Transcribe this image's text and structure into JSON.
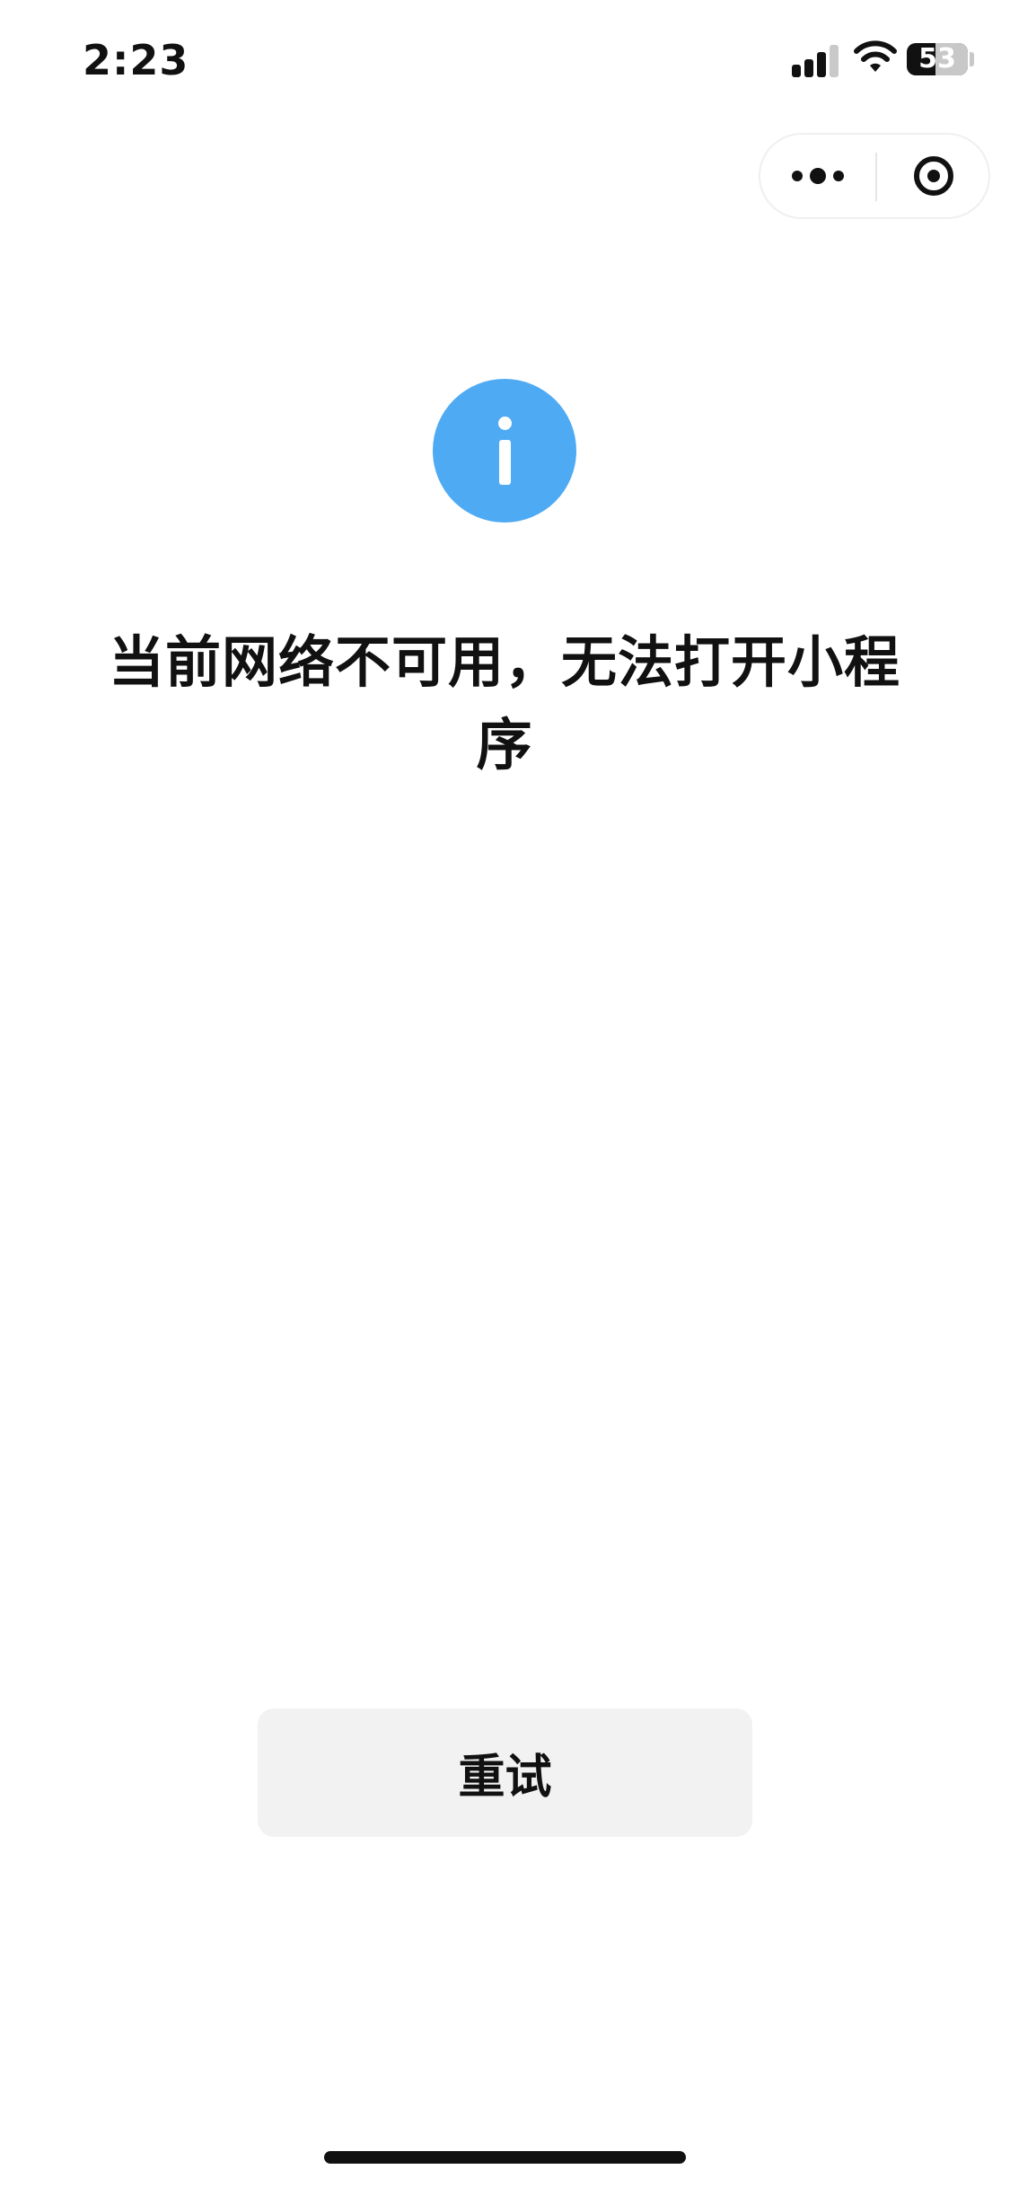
{
  "status_bar": {
    "time": "2:23",
    "battery_level": "53",
    "icons": [
      "cellular-signal-icon",
      "wifi-icon",
      "battery-icon"
    ]
  },
  "capsule": {
    "more_icon": "more-dots-icon",
    "close_icon": "close-target-icon"
  },
  "info_icon": {
    "name": "info-icon",
    "color": "#4faaf4"
  },
  "message": "当前网络不可用，无法打开小程序",
  "retry_label": "重试",
  "colors": {
    "background": "#ffffff",
    "text": "#111111",
    "button_bg": "#f2f2f2"
  }
}
